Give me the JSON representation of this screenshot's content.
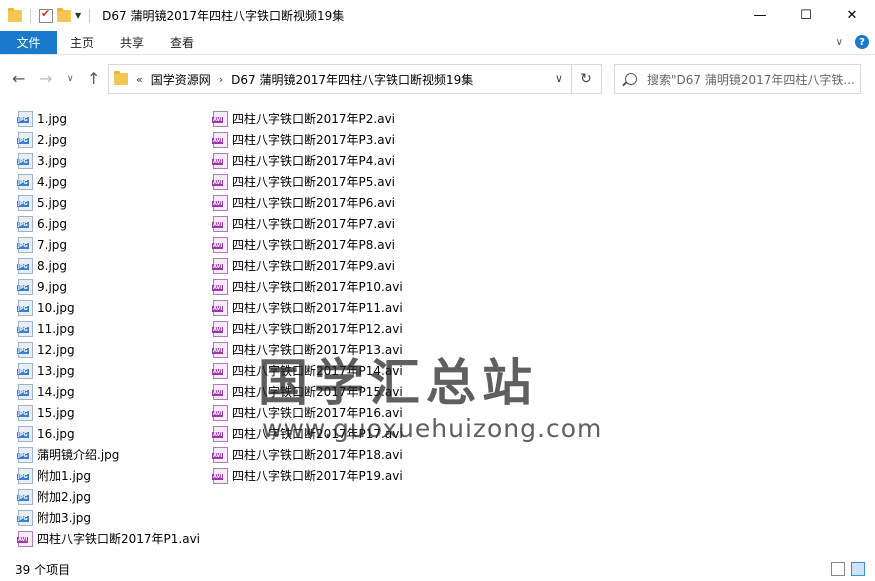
{
  "window": {
    "title": "D67 蒲明镜2017年四柱八字铁口断视频19集",
    "minimize": "—",
    "maximize": "☐",
    "close": "✕"
  },
  "ribbon": {
    "tabs": [
      "文件",
      "主页",
      "共享",
      "查看"
    ],
    "help": "?"
  },
  "address": {
    "prefix": "«",
    "crumbs": [
      "国学资源网",
      "D67 蒲明镜2017年四柱八字铁口断视频19集"
    ],
    "search_placeholder": "搜索\"D67 蒲明镜2017年四柱八字铁..."
  },
  "files_col1": [
    {
      "name": "1.jpg",
      "type": "jpg"
    },
    {
      "name": "2.jpg",
      "type": "jpg"
    },
    {
      "name": "3.jpg",
      "type": "jpg"
    },
    {
      "name": "4.jpg",
      "type": "jpg"
    },
    {
      "name": "5.jpg",
      "type": "jpg"
    },
    {
      "name": "6.jpg",
      "type": "jpg"
    },
    {
      "name": "7.jpg",
      "type": "jpg"
    },
    {
      "name": "8.jpg",
      "type": "jpg"
    },
    {
      "name": "9.jpg",
      "type": "jpg"
    },
    {
      "name": "10.jpg",
      "type": "jpg"
    },
    {
      "name": "11.jpg",
      "type": "jpg"
    },
    {
      "name": "12.jpg",
      "type": "jpg"
    },
    {
      "name": "13.jpg",
      "type": "jpg"
    },
    {
      "name": "14.jpg",
      "type": "jpg"
    },
    {
      "name": "15.jpg",
      "type": "jpg"
    },
    {
      "name": "16.jpg",
      "type": "jpg"
    },
    {
      "name": "蒲明镜介绍.jpg",
      "type": "jpg"
    },
    {
      "name": "附加1.jpg",
      "type": "jpg"
    },
    {
      "name": "附加2.jpg",
      "type": "jpg"
    },
    {
      "name": "附加3.jpg",
      "type": "jpg"
    },
    {
      "name": "四柱八字铁口断2017年P1.avi",
      "type": "avi"
    }
  ],
  "files_col2": [
    {
      "name": "四柱八字铁口断2017年P2.avi",
      "type": "avi"
    },
    {
      "name": "四柱八字铁口断2017年P3.avi",
      "type": "avi"
    },
    {
      "name": "四柱八字铁口断2017年P4.avi",
      "type": "avi"
    },
    {
      "name": "四柱八字铁口断2017年P5.avi",
      "type": "avi"
    },
    {
      "name": "四柱八字铁口断2017年P6.avi",
      "type": "avi"
    },
    {
      "name": "四柱八字铁口断2017年P7.avi",
      "type": "avi"
    },
    {
      "name": "四柱八字铁口断2017年P8.avi",
      "type": "avi"
    },
    {
      "name": "四柱八字铁口断2017年P9.avi",
      "type": "avi"
    },
    {
      "name": "四柱八字铁口断2017年P10.avi",
      "type": "avi"
    },
    {
      "name": "四柱八字铁口断2017年P11.avi",
      "type": "avi"
    },
    {
      "name": "四柱八字铁口断2017年P12.avi",
      "type": "avi"
    },
    {
      "name": "四柱八字铁口断2017年P13.avi",
      "type": "avi"
    },
    {
      "name": "四柱八字铁口断2017年P14.avi",
      "type": "avi"
    },
    {
      "name": "四柱八字铁口断2017年P15.avi",
      "type": "avi"
    },
    {
      "name": "四柱八字铁口断2017年P16.avi",
      "type": "avi"
    },
    {
      "name": "四柱八字铁口断2017年P17.avi",
      "type": "avi"
    },
    {
      "name": "四柱八字铁口断2017年P18.avi",
      "type": "avi"
    },
    {
      "name": "四柱八字铁口断2017年P19.avi",
      "type": "avi"
    }
  ],
  "watermark": {
    "line1": "国学汇总站",
    "line2": "www.guoxuehuizong.com"
  },
  "status": {
    "count": "39 个项目"
  },
  "colors": {
    "accent": "#1979ca",
    "avi": "#9b3aa6",
    "jpg": "#3a7fcf"
  }
}
